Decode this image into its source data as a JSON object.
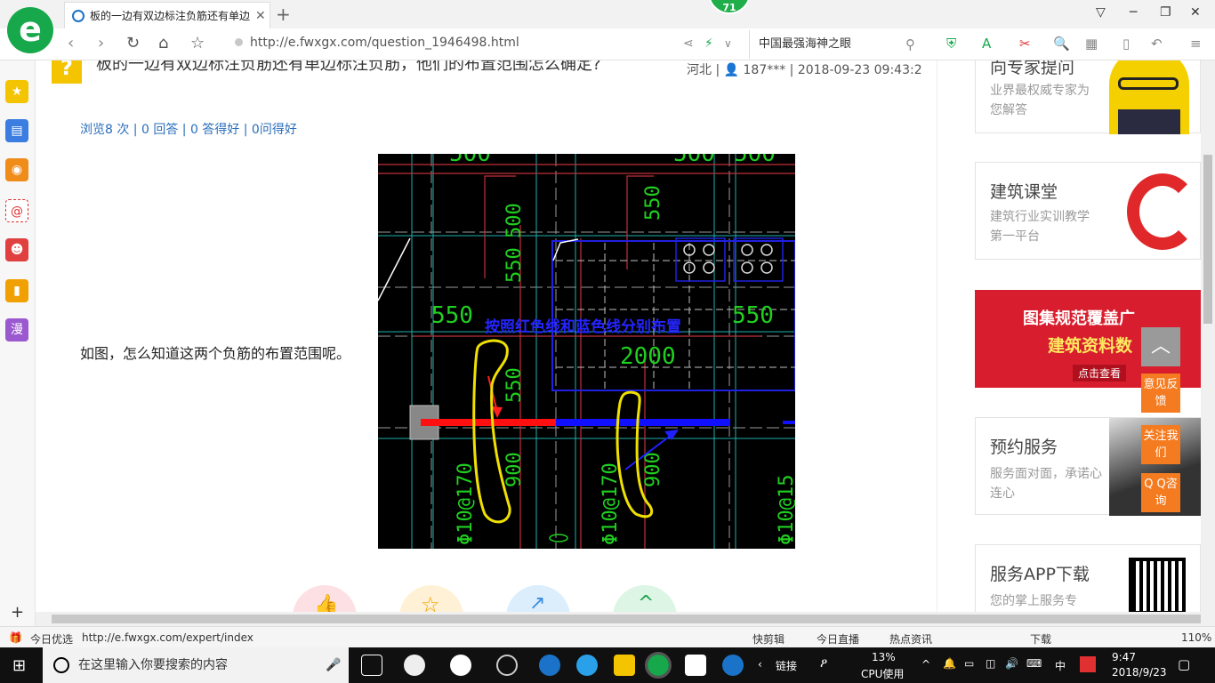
{
  "browser": {
    "tab_title": "板的一边有双边标注负筋还有单边",
    "tab_close": "✕",
    "new_tab": "+",
    "notif_count": "71",
    "url": "http://e.fwxgx.com/question_1946498.html",
    "search_text": "中国最强海神之眼",
    "logo_letter": "e"
  },
  "sidebar": {
    "items": [
      {
        "name": "favorites",
        "glyph": "★",
        "color": "#f5c400"
      },
      {
        "name": "news",
        "glyph": "▤",
        "color": "#3b7de0"
      },
      {
        "name": "weibo",
        "glyph": "◉",
        "color": "#f08c1a"
      },
      {
        "name": "mail",
        "glyph": "@",
        "color": "#e03030"
      },
      {
        "name": "game",
        "glyph": "☻",
        "color": "#e04040"
      },
      {
        "name": "reader",
        "glyph": "▮",
        "color": "#f0a000"
      },
      {
        "name": "comic",
        "glyph": "漫",
        "color": "#9b59d0"
      }
    ],
    "add": "+"
  },
  "question": {
    "icon": "?",
    "title": "板的一边有双边标注负筋还有单边标注负筋，他们的布置范围怎么确定?",
    "meta": "河北 | 👤 187*** | 2018-09-23 09:43:2",
    "stats": "浏览8 次 | 0 回答 | 0 答得好 | 0问得好",
    "body": "如图，怎么知道这两个负筋的布置范围呢。"
  },
  "cad": {
    "labels": [
      "500",
      "500",
      "500",
      "500",
      "550",
      "550",
      "550",
      "550",
      "2000",
      "550",
      "900",
      "900"
    ],
    "rebar1": "Φ10@170",
    "rebar2": "Φ10@170",
    "rebar3": "Φ10@15",
    "annotation": "按照红色线和蓝色线分别布置"
  },
  "right": {
    "card1": {
      "title": "向专家提问",
      "sub": "业界最权威专家为您解答"
    },
    "card2": {
      "title": "建筑课堂",
      "sub": "建筑行业实训教学第一平台"
    },
    "banner": {
      "line1": "图集规范覆盖广",
      "line2": "建筑资料数",
      "link": "点击查看"
    },
    "card3": {
      "title": "预约服务",
      "sub": "服务面对面，承诺心连心"
    },
    "card4": {
      "title": "服务APP下载",
      "sub": "您的掌上服务专"
    },
    "float": {
      "totop": "︿",
      "feedback": "意见反馈",
      "follow": "关注我们",
      "qq": "Q Q咨询"
    }
  },
  "statusbar": {
    "left": "今日优选",
    "url": "http://e.fwxgx.com/expert/index",
    "items": [
      "快剪辑",
      "今日直播",
      "热点资讯",
      "下载"
    ],
    "zoom": "110%"
  },
  "taskbar": {
    "search": "在这里输入你要搜索的内容",
    "link": "链接",
    "cpu_pct": "13%",
    "cpu_label": "CPU使用",
    "ime": "中",
    "time": "9:47",
    "date": "2018/9/23"
  }
}
